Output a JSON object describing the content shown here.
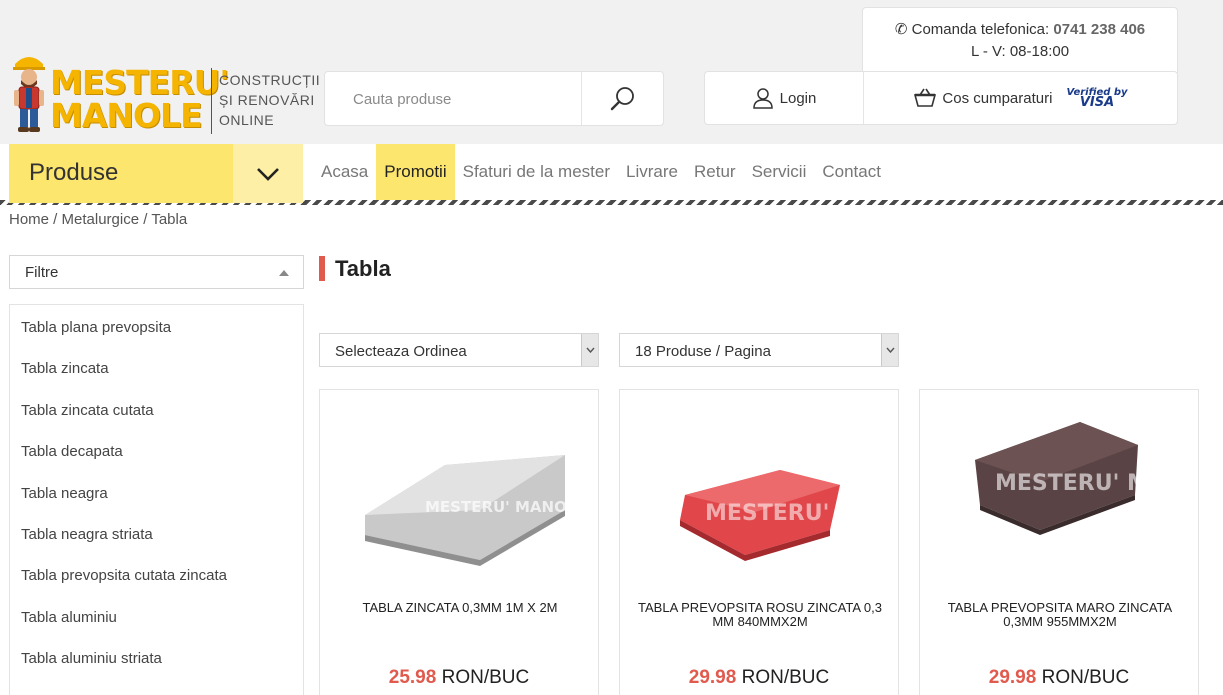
{
  "brand": {
    "name_line1": "MESTERU'",
    "name_line2": "MANOLE",
    "tagline_line1": "CONSTRUCȚII",
    "tagline_line2": "ȘI RENOVĂRI",
    "tagline_line3": "ONLINE",
    "accent_color": "#f4b400"
  },
  "search": {
    "placeholder": "Cauta produse",
    "button_icon": "search-icon"
  },
  "contact": {
    "phone_label": "Comanda telefonica:",
    "phone_number": "0741 238 406",
    "hours": "L - V: 08-18:00"
  },
  "account": {
    "login_label": "Login",
    "cart_label": "Cos cumparaturi",
    "visa_top": "Verified by",
    "visa_bottom": "VISA"
  },
  "nav": {
    "products_label": "Produse",
    "items": [
      {
        "label": "Acasa",
        "active": false
      },
      {
        "label": "Promotii",
        "active": true
      },
      {
        "label": "Sfaturi de la mester",
        "active": false
      },
      {
        "label": "Livrare",
        "active": false
      },
      {
        "label": "Retur",
        "active": false
      },
      {
        "label": "Servicii",
        "active": false
      },
      {
        "label": "Contact",
        "active": false
      }
    ],
    "highlight_color": "#fde66d"
  },
  "breadcrumb": [
    "Home",
    "Metalurgice",
    "Tabla"
  ],
  "sidebar": {
    "filter_label": "Filtre",
    "categories": [
      "Tabla plana prevopsita",
      "Tabla zincata",
      "Tabla zincata cutata",
      "Tabla decapata",
      "Tabla neagra",
      "Tabla neagra striata",
      "Tabla prevopsita cutata zincata",
      "Tabla aluminiu",
      "Tabla aluminiu striata"
    ]
  },
  "main": {
    "title": "Tabla",
    "title_accent": "#e05a4e",
    "sort_label": "Selecteaza Ordinea",
    "per_page_label": "18 Produse / Pagina"
  },
  "products": [
    {
      "name": "TABLA ZINCATA 0,3MM 1M X 2M",
      "price": "25.98",
      "unit": "RON/BUC",
      "sheet_color": "#c9c9c9",
      "watermark": "MESTERU' MANOLE"
    },
    {
      "name": "TABLA PREVOPSITA ROSU ZINCATA 0,3 MM 840MMX2M",
      "price": "29.98",
      "unit": "RON/BUC",
      "sheet_color": "#e0464a",
      "watermark": "MESTERU' MANOLE"
    },
    {
      "name": "TABLA PREVOPSITA MARO ZINCATA 0,3MM 955MMX2M",
      "price": "29.98",
      "unit": "RON/BUC",
      "sheet_color": "#5a4344",
      "watermark": "MESTERU' MANOLE"
    }
  ]
}
